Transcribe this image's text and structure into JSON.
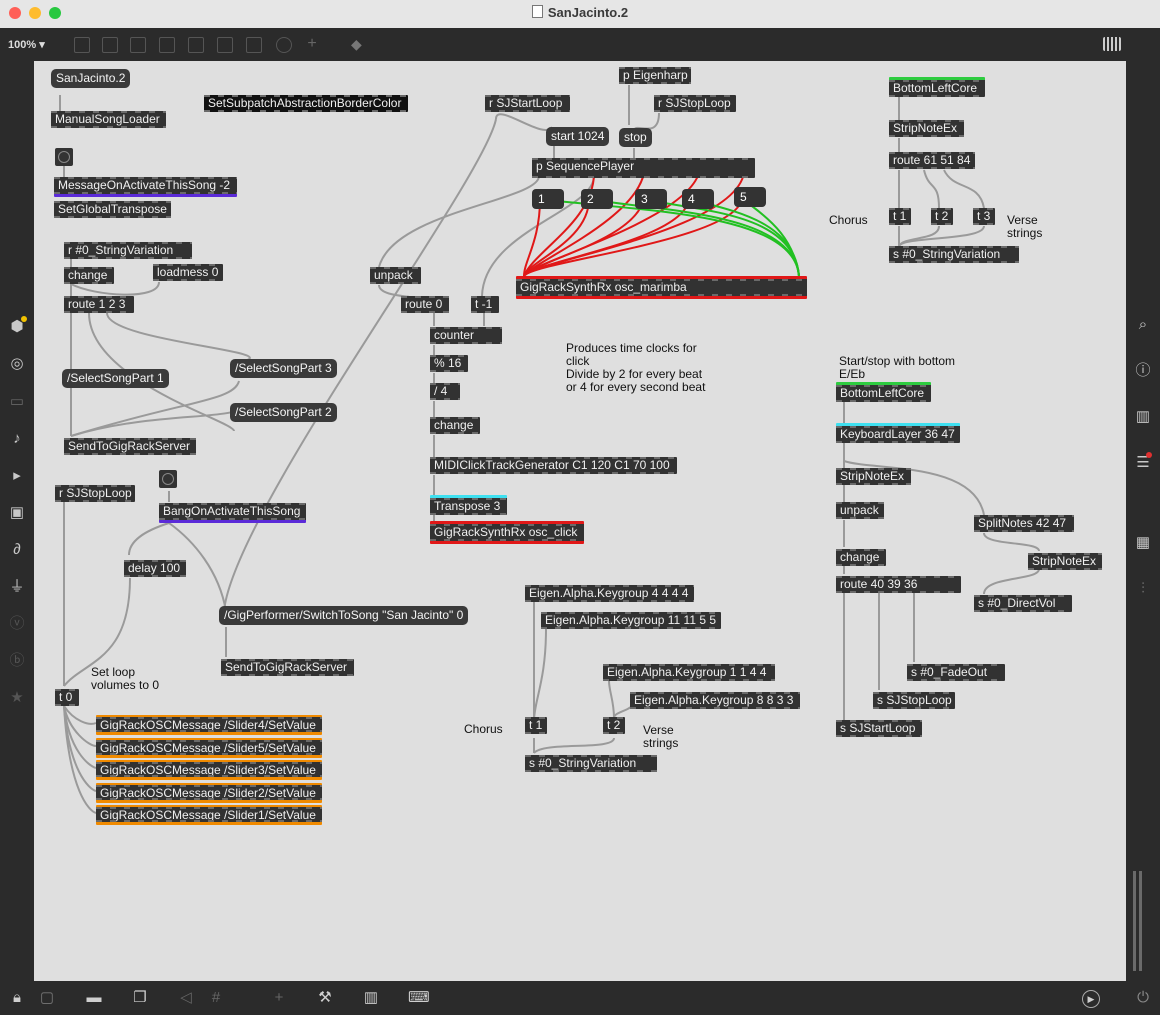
{
  "window": {
    "title": "SanJacinto.2",
    "traffic_lights": {
      "close": "#ff5f57",
      "minimize": "#febc2e",
      "zoom": "#28c840"
    }
  },
  "toolbar": {
    "zoom": "100%"
  },
  "patch": {
    "objects": {
      "sanjacinto_msg": "SanJacinto.2",
      "manual_song_loader": "ManualSongLoader",
      "set_border_color": "SetSubpatchAbstractionBorderColor",
      "msg_on_activate": "MessageOnActivateThisSong -2",
      "set_global_transpose": "SetGlobalTranspose",
      "r_string_variation": "r #0_StringVariation",
      "change1": "change",
      "loadmess": "loadmess 0",
      "route123": "route 1 2 3",
      "select_part1": "/SelectSongPart 1",
      "select_part3": "/SelectSongPart 3",
      "select_part2": "/SelectSongPart 2",
      "send_server1": "SendToGigRackServer",
      "r_stoploop1": "r SJStopLoop",
      "bang_on_activate": "BangOnActivateThisSong",
      "delay100": "delay 100",
      "switch_to_song": "/GigPerformer/SwitchToSong \"San Jacinto\" 0",
      "send_server2": "SendToGigRackServer",
      "t0": "t 0",
      "osc_slider4": "GigRackOSCMessage /Slider4/SetValue",
      "osc_slider5": "GigRackOSCMessage /Slider5/SetValue",
      "osc_slider3": "GigRackOSCMessage /Slider3/SetValue",
      "osc_slider2": "GigRackOSCMessage /Slider2/SetValue",
      "osc_slider1": "GigRackOSCMessage /Slider1/SetValue",
      "r_startloop": "r SJStartLoop",
      "start1024": "start 1024",
      "p_eigenharp": "p Eigenharp",
      "r_stoploop2": "r SJStopLoop",
      "stop": "stop",
      "p_sequence_player": "p SequencePlayer",
      "num1": "1",
      "num2": "2",
      "num3": "3",
      "num4": "4",
      "num5": "5",
      "unpack1": "unpack",
      "route0": "route 0",
      "t_minus1": "t -1",
      "synth_marimba": "GigRackSynthRx osc_marimba",
      "counter": "counter",
      "mod16": "% 16",
      "div4": "/ 4",
      "change2": "change",
      "midi_click": "MIDIClickTrackGenerator C1 120 C1 70 100",
      "transpose3": "Transpose 3",
      "synth_click": "GigRackSynthRx osc_click",
      "eigen_4444": "Eigen.Alpha.Keygroup 4 4 4 4",
      "eigen_111155": "Eigen.Alpha.Keygroup 11 11 5 5",
      "eigen_1144": "Eigen.Alpha.Keygroup 1 1 4 4",
      "eigen_8833": "Eigen.Alpha.Keygroup 8 8 3 3",
      "t1_mid": "t 1",
      "t2_mid": "t 2",
      "s_string_variation_mid": "s #0_StringVariation",
      "bottom_left_core1": "BottomLeftCore",
      "stripnote1": "StripNoteEx",
      "route615184": "route 61 51 84",
      "t1_right": "t 1",
      "t2_right": "t 2",
      "t3_right": "t 3",
      "s_string_variation_right": "s #0_StringVariation",
      "bottom_left_core2": "BottomLeftCore",
      "keyboard_layer": "KeyboardLayer 36 47",
      "stripnote2": "StripNoteEx",
      "unpack2": "unpack",
      "split_notes": "SplitNotes 42 47",
      "stripnote3": "StripNoteEx",
      "change3": "change",
      "route403936": "route 40 39 36",
      "s_direct_vol": "s #0_DirectVol",
      "s_fadeout": "s #0_FadeOut",
      "s_stoploop": "s SJStopLoop",
      "s_startloop": "s SJStartLoop"
    },
    "comments": {
      "set_loop_volumes": "Set loop\nvolumes to 0",
      "time_clocks": "Produces time clocks for\nclick\nDivide by 2 for every beat\nor 4 for every second beat",
      "chorus_mid": "Chorus",
      "verse_strings_mid": "Verse\nstrings",
      "chorus_right": "Chorus",
      "verse_strings_right": "Verse\nstrings",
      "start_stop": "Start/stop with bottom\nE/Eb"
    }
  },
  "colors": {
    "canvas": "#dfdfdf",
    "object": "#323232",
    "patchcord": "#9a9a9a",
    "signal_red": "#e01818",
    "signal_green": "#22c022",
    "border_purple": "#5b2bd8",
    "border_green": "#2ecc40",
    "border_cyan": "#3ee0f0",
    "border_orange": "#f08a00"
  },
  "sidebar_left": [
    "package-icon",
    "target-icon",
    "keyboard-icon",
    "music-note-icon",
    "playlist-icon",
    "image-icon",
    "paperclip-icon",
    "plug-icon",
    "v-icon",
    "b-icon",
    "star-icon"
  ],
  "sidebar_right": [
    "search-icon",
    "info-icon",
    "book-icon",
    "list-icon",
    "camera-icon",
    "sliders-icon"
  ],
  "bottom_bar": [
    "lock-icon",
    "edit-icon",
    "presentation-icon",
    "windows-icon",
    "mute-icon",
    "grid-icon",
    "add-icon",
    "wrench-icon",
    "piano-icon",
    "keyboard-icon",
    "play-icon",
    "power-icon"
  ]
}
